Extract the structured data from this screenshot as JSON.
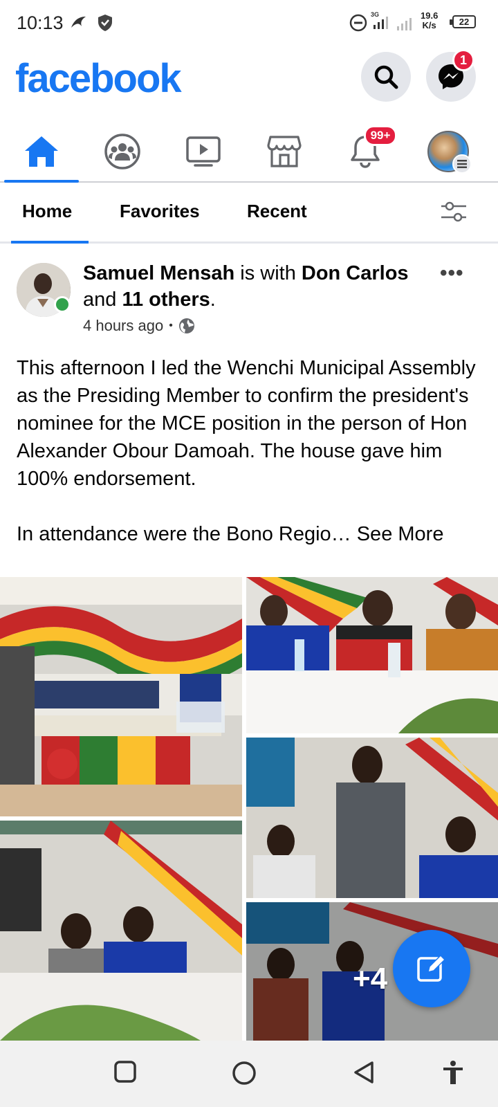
{
  "status_bar": {
    "time": "10:13",
    "speed_value": "19.6",
    "speed_unit": "K/s",
    "network": "3G",
    "battery": "22"
  },
  "header": {
    "logo": "facebook",
    "messenger_badge": "1"
  },
  "nav": {
    "notifications_badge": "99+",
    "active": "home"
  },
  "tabs": [
    {
      "label": "Home"
    },
    {
      "label": "Favorites"
    },
    {
      "label": "Recent"
    }
  ],
  "post": {
    "author": "Samuel Mensah",
    "with_text": " is with ",
    "tagged": "Don Carlos",
    "and_text": " and ",
    "others": "11 others",
    "period": ".",
    "time": "4 hours ago",
    "separator": "•",
    "text_p1": "This afternoon I led the Wenchi Municipal Assembly as the Presiding Member to confirm the president's nominee for the MCE position in the person of Hon Alexander Obour Damoah. The house gave him 100% endorsement.",
    "text_p2": "In attendance were the Bono Regio…",
    "see_more": "See More",
    "extra_photos": "+4"
  },
  "colors": {
    "brand": "#1877f2",
    "badge": "#e41e3f",
    "online": "#31a24c"
  }
}
